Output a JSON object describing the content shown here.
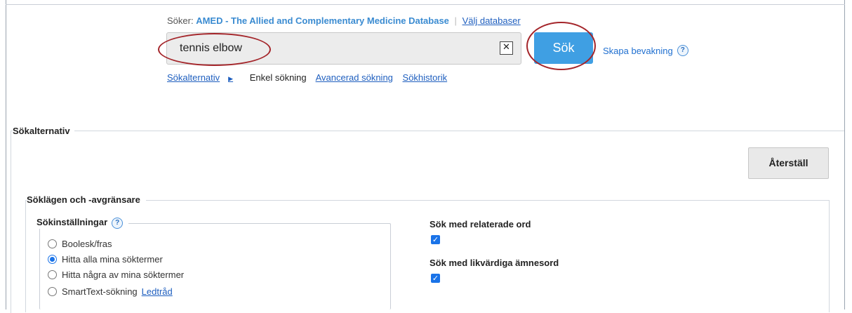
{
  "search": {
    "searching_label": "Söker:",
    "database_name": "AMED - The Allied and Complementary Medicine Database",
    "choose_databases": "Välj databaser",
    "query": "tennis elbow",
    "clear_glyph": "✕",
    "submit_label": "Sök",
    "create_alert_label": "Skapa bevakning",
    "help_glyph": "?"
  },
  "tabs": {
    "options_label": "Sökalternativ",
    "options_caret": "▶",
    "basic_label": "Enkel sökning",
    "advanced_label": "Avancerad sökning",
    "history_label": "Sökhistorik"
  },
  "options_panel": {
    "legend": "Sökalternativ",
    "reset_label": "Återställ",
    "modes_legend": "Söklägen och -avgränsare",
    "settings_legend": "Sökinställningar",
    "settings_help_glyph": "?",
    "modes": [
      {
        "label": "Boolesk/fras",
        "checked": false
      },
      {
        "label": "Hitta alla mina söktermer",
        "checked": true
      },
      {
        "label": "Hitta några av mina söktermer",
        "checked": false
      },
      {
        "label": "SmartText-sökning",
        "checked": false
      }
    ],
    "hint_label": "Ledtråd",
    "related_words_label": "Sök med relaterade ord",
    "related_words_checked": true,
    "equivalent_subjects_label": "Sök med likvärdiga ämnesord",
    "equivalent_subjects_checked": true,
    "check_glyph": "✓"
  },
  "colors": {
    "accent": "#3f9fe3",
    "link": "#1f5fbf",
    "annotation": "#a4252a"
  }
}
